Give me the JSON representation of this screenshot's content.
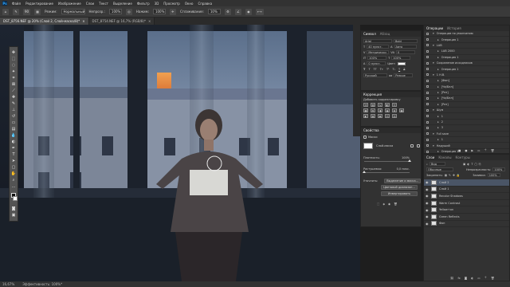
{
  "menubar": {
    "items": [
      "Файл",
      "Редактирование",
      "Изображение",
      "Слои",
      "Текст",
      "Выделение",
      "Фильтр",
      "3D",
      "Просмотр",
      "Окно",
      "Справка"
    ]
  },
  "options": {
    "brush_size": "90",
    "mode_label": "Режим:",
    "mode_value": "Нормальный",
    "opacity_label": "Непрозр.:",
    "opacity_value": "100%",
    "flow_label": "Нажим:",
    "flow_value": "100%",
    "smoothing_label": "Сглаживание:",
    "smoothing_value": "10%"
  },
  "tabs": [
    {
      "label": "DST_8756.NEF @ 20% (Слой 2, Слой-маска/8)*"
    },
    {
      "label": "DST_8754.NEF @ 16,7% (RGB/8)*"
    }
  ],
  "status": {
    "zoom": "16,67%",
    "doc": "Эффективность: 100%*"
  },
  "swatches_panel": {
    "tabs": [
      "Символ",
      "Абзац"
    ],
    "font_family": "Arial",
    "font_style": "Bold",
    "font_size": "40 пункт.",
    "leading": "Авто",
    "tracking": "Метрически",
    "kerning": "0",
    "scale_v": "100%",
    "scale_h": "100%",
    "baseline": "0 пункт.",
    "color_label": "Цвет:",
    "language": "Русский",
    "aa_label": "аа",
    "aa_value": "Резкое"
  },
  "correction_panel": {
    "title": "Коррекция",
    "subtitle": "Добавить корректировку"
  },
  "properties_panel": {
    "title": "Свойства",
    "mask_label": "Маски",
    "layer_mask_label": "Слой-маска",
    "density_label": "Плотность:",
    "density_value": "100%",
    "feather_label": "Растушевка:",
    "feather_value": "0,0 пикс.",
    "refine_label": "Уточнить:",
    "btn_select_mask": "Выделение и маска...",
    "btn_color_range": "Цветовой диапазон...",
    "btn_invert": "Инвертировать"
  },
  "history_panel": {
    "tabs": [
      "Операции",
      "История"
    ],
    "items": [
      {
        "label": "Операции по умолчанию",
        "level": 1
      },
      {
        "label": "Операция 1",
        "level": 2
      },
      {
        "label": "LAB",
        "level": 1
      },
      {
        "label": "LAB 2000",
        "level": 2
      },
      {
        "label": "Операция 1",
        "level": 2
      },
      {
        "label": "Сохранение исходников",
        "level": 1
      },
      {
        "label": "Операция 1",
        "level": 2
      },
      {
        "label": "1 H.B.",
        "level": 1
      },
      {
        "label": "[Фон]",
        "level": 2
      },
      {
        "label": "[Ча/Бел]",
        "level": 2
      },
      {
        "label": "[Рез]",
        "level": 2
      },
      {
        "label": "[Ча/Бел]",
        "level": 2
      },
      {
        "label": "[Рез]",
        "level": 2
      },
      {
        "label": "Шум",
        "level": 1
      },
      {
        "label": "1",
        "level": 2
      },
      {
        "label": "2",
        "level": 2
      },
      {
        "label": "3",
        "level": 2
      },
      {
        "label": "Full save",
        "level": 1
      },
      {
        "label": "1",
        "level": 2
      },
      {
        "label": "Надуший",
        "level": 1
      },
      {
        "label": "Операция 1",
        "level": 2
      }
    ]
  },
  "layers_panel": {
    "tabs": [
      "Слои",
      "Каналы",
      "Контуры"
    ],
    "kind_label": "Вид",
    "blend_mode": "Обычные",
    "opacity_label": "Непрозрачность:",
    "opacity_value": "100%",
    "lock_label": "Закрепить:",
    "fill_label": "Заливка:",
    "fill_value": "100%",
    "layers": [
      {
        "name": "Слой 2",
        "selected": true
      },
      {
        "name": "Слой 1",
        "selected": false
      },
      {
        "name": "Recolor Shadows",
        "selected": false
      },
      {
        "name": "Warm Contrast",
        "selected": false
      },
      {
        "name": "Yellow+on",
        "selected": false
      },
      {
        "name": "Green Reflects",
        "selected": false
      },
      {
        "name": "Фон",
        "selected": false
      }
    ]
  },
  "colors": {
    "accent": "#4a5566",
    "sky_top": "#6b7f9a",
    "sky_glow": "#e48a3c",
    "building": "#7c8698",
    "frame": "#1c222c"
  }
}
